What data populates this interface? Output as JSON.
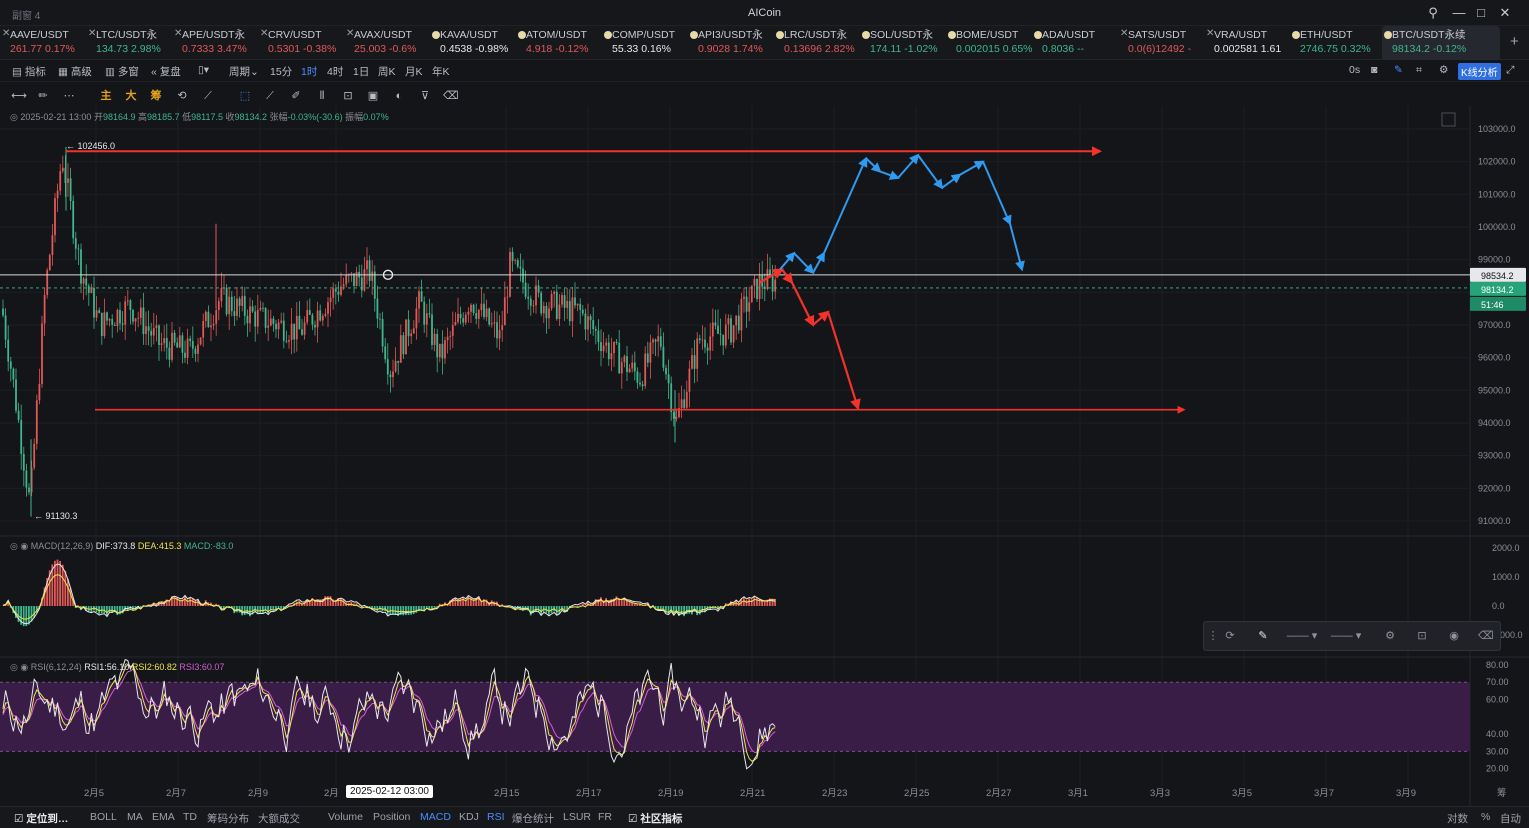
{
  "window": {
    "left_label": "副窗 4",
    "title": "AICoin"
  },
  "tabs": [
    {
      "name": "AAVE/USDT",
      "price": "261.77",
      "change": "0.17%",
      "dir": "up",
      "mark": "x"
    },
    {
      "name": "LTC/USDT永",
      "price": "134.73",
      "change": "2.98%",
      "dir": "dn",
      "mark": "x"
    },
    {
      "name": "APE/USDT永",
      "price": "0.7333",
      "change": "3.47%",
      "dir": "up",
      "mark": "x"
    },
    {
      "name": "CRV/USDT",
      "price": "0.5301",
      "change": "-0.38%",
      "dir": "up",
      "mark": "x"
    },
    {
      "name": "AVAX/USDT",
      "price": "25.003",
      "change": "-0.6%",
      "dir": "up",
      "mark": "x"
    },
    {
      "name": "KAVA/USDT",
      "price": "0.4538",
      "change": "-0.98%",
      "dir": "wh",
      "mark": "dot"
    },
    {
      "name": "ATOM/USDT",
      "price": "4.918",
      "change": "-0.12%",
      "dir": "up",
      "mark": "dot"
    },
    {
      "name": "COMP/USDT",
      "price": "55.33",
      "change": "0.16%",
      "dir": "wh",
      "mark": "dot"
    },
    {
      "name": "API3/USDT永",
      "price": "0.9028",
      "change": "1.74%",
      "dir": "up",
      "mark": "dot"
    },
    {
      "name": "LRC/USDT永",
      "price": "0.13696",
      "change": "2.82%",
      "dir": "up",
      "mark": "dot"
    },
    {
      "name": "SOL/USDT永",
      "price": "174.11",
      "change": "-1.02%",
      "dir": "dn",
      "mark": "dot"
    },
    {
      "name": "BOME/USDT",
      "price": "0.002015",
      "change": "0.65%",
      "dir": "dn",
      "mark": "dot"
    },
    {
      "name": "ADA/USDT",
      "price": "0.8036",
      "change": "--",
      "dir": "dn",
      "mark": "dot"
    },
    {
      "name": "SATS/USDT",
      "price": "0.0(6)12492",
      "change": "-",
      "dir": "up",
      "mark": "x"
    },
    {
      "name": "VRA/USDT",
      "price": "0.002581",
      "change": "1.61",
      "dir": "wh",
      "mark": "x"
    },
    {
      "name": "ETH/USDT",
      "price": "2746.75",
      "change": "0.32%",
      "dir": "dn",
      "mark": "dot"
    },
    {
      "name": "BTC/USDT永续",
      "price": "98134.2",
      "change": "-0.12%",
      "dir": "dn",
      "mark": "dot",
      "active": true
    }
  ],
  "toolbar1": {
    "items": [
      "指标",
      "高级",
      "多窗",
      "复盘",
      "",
      "周期",
      "15分",
      "1时",
      "4时",
      "1日",
      "周K",
      "月K",
      "年K"
    ],
    "selected": "1时",
    "right_label": "0s",
    "kline_button": "K线分析"
  },
  "toolbar2": {
    "labels": [
      "主",
      "大",
      "筹"
    ]
  },
  "ohlc": {
    "datetime": "2025-02-21 13:00",
    "open_label": "开",
    "open": "98164.9",
    "high_label": "高",
    "high": "98185.7",
    "low_label": "低",
    "low": "98117.5",
    "close_label": "收",
    "close": "98134.2",
    "chg_label": "张幅",
    "chg": "-0.03%(-30.6)",
    "amp_label": "振幅",
    "amp": "0.07%"
  },
  "price_axis": {
    "ticks": [
      "103000.0",
      "102000.0",
      "101000.0",
      "100000.0",
      "99000.0",
      "98000.0",
      "97000.0",
      "96000.0",
      "95000.0",
      "94000.0",
      "93000.0",
      "92000.0",
      "91000.0"
    ],
    "tag_line": "98534.2",
    "tag_price": "98134.2",
    "tag_time": "51:46"
  },
  "annotations": {
    "high": "← 102456.0",
    "low": "← 91130.3"
  },
  "macd": {
    "name": "MACD(12,26,9)",
    "dif": "DIF:373.8",
    "dea": "DEA:415.3",
    "macd": "MACD:-83.0",
    "ticks": [
      "2000.0",
      "1000.0",
      "0.0",
      "-1000.0"
    ]
  },
  "rsi": {
    "name": "RSI(6,12,24)",
    "rsi1": "RSI1:56.10",
    "rsi2": "RSI2:60.82",
    "rsi3": "RSI3:60.07",
    "ticks": [
      "80.00",
      "70.00",
      "60.00",
      "40.00",
      "30.00",
      "20.00"
    ]
  },
  "x_axis": {
    "labels": [
      "2月5",
      "2月7",
      "2月9",
      "2月",
      "2月15",
      "2月17",
      "2月19",
      "2月21",
      "2月23",
      "2月25",
      "2月27",
      "3月1",
      "3月3",
      "3月5",
      "3月7",
      "3月9"
    ],
    "hover_date": "2025-02-12 03:00",
    "right": "筹"
  },
  "bottombar": {
    "locate": "定位到…",
    "items": [
      "BOLL",
      "MA",
      "EMA",
      "TD",
      "筹码分布",
      "大额成交",
      "Volume",
      "Position",
      "MACD",
      "KDJ",
      "RSI",
      "爆仓统计",
      "LSUR",
      "FR",
      "社区指标"
    ],
    "selected": [
      "MACD",
      "RSI"
    ],
    "right": [
      "对数",
      "%",
      "自动"
    ]
  },
  "colors": {
    "up": "#e05858",
    "down": "#3fb68b",
    "accent": "#4a8dff",
    "arrow_red": "#f2322b",
    "arrow_blue": "#2e9bf0"
  }
}
